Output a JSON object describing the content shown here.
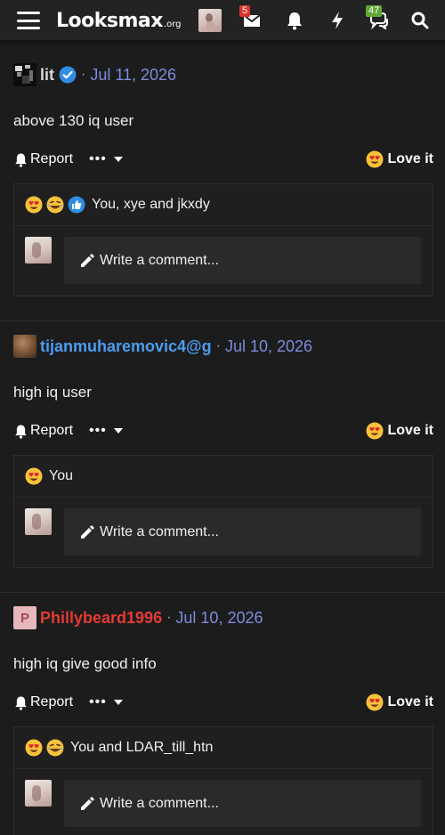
{
  "nav": {
    "logo_main": "Looksmax",
    "logo_tld": ".org",
    "inbox_badge": "5",
    "alerts_badge": "47"
  },
  "posts": [
    {
      "author": "lit",
      "author_color": "#d8d8d8",
      "verified": true,
      "date": "Jul 11, 2026",
      "text": "above 130 iq user",
      "reactions": [
        "heart-eyes",
        "laughing-crying",
        "thumbs-up"
      ],
      "reacted_by": "You, xye and jkxdy"
    },
    {
      "author": "tijanmuharemovic4@g",
      "author_color": "#4a9df0",
      "verified": false,
      "date": "Jul 10, 2026",
      "text": "high iq user",
      "reactions": [
        "heart-eyes"
      ],
      "reacted_by": "You"
    },
    {
      "author": "Phillybeard1996",
      "author_color": "#e23b33",
      "avatar_letter": "P",
      "verified": false,
      "date": "Jul 10, 2026",
      "text": "high iq give good info",
      "reactions": [
        "heart-eyes",
        "laughing-crying"
      ],
      "reacted_by": "You and LDAR_till_htn"
    }
  ],
  "labels": {
    "separator": "·",
    "report": "Report",
    "more": "•••",
    "love_it": "Love it",
    "write_comment": "Write a comment..."
  }
}
